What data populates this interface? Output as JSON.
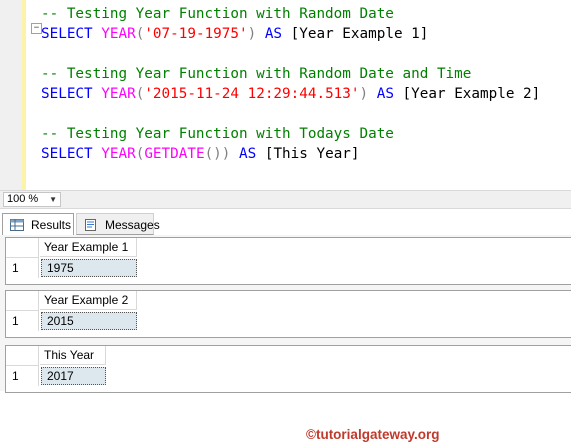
{
  "editor": {
    "outline_toggle": "−",
    "lines": [
      {
        "comment": "-- Testing Year Function with Random Date"
      },
      {
        "kw_select": "SELECT",
        "fn": "YEAR",
        "open": "(",
        "arg": "'07-19-1975'",
        "close": ")",
        "kw_as": "AS",
        "alias": "[Year Example 1]"
      },
      {
        "comment": "-- Testing Year Function with Random Date and Time"
      },
      {
        "kw_select": "SELECT",
        "fn": "YEAR",
        "open": "(",
        "arg": "'2015-11-24 12:29:44.513'",
        "close": ")",
        "kw_as": "AS",
        "alias": "[Year Example 2]"
      },
      {
        "comment": "-- Testing Year Function with Todays Date"
      },
      {
        "kw_select": "SELECT",
        "fn": "YEAR",
        "open": "(",
        "fn2": "GETDATE",
        "inner": "()",
        "close": ")",
        "kw_as": "AS",
        "alias": "[This Year]"
      }
    ]
  },
  "zoom": {
    "value": "100 %"
  },
  "tabs": [
    {
      "label": "Results",
      "icon": "grid-icon"
    },
    {
      "label": "Messages",
      "icon": "messages-icon"
    }
  ],
  "watermark": "©tutorialgateway.org",
  "results": [
    {
      "column": "Year Example 1",
      "row_number": "1",
      "value": "1975"
    },
    {
      "column": "Year Example 2",
      "row_number": "1",
      "value": "2015"
    },
    {
      "column": "This Year",
      "row_number": "1",
      "value": "2017"
    }
  ]
}
